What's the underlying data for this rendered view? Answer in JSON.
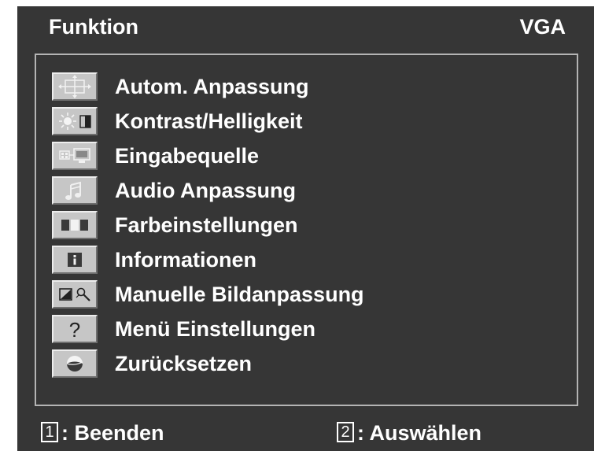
{
  "header": {
    "title": "Funktion",
    "source": "VGA"
  },
  "menu": {
    "items": [
      {
        "label": "Autom. Anpassung",
        "icon": "auto-adjust-icon"
      },
      {
        "label": "Kontrast/Helligkeit",
        "icon": "contrast-brightness-icon"
      },
      {
        "label": "Eingabequelle",
        "icon": "input-source-icon"
      },
      {
        "label": "Audio Anpassung",
        "icon": "audio-note-icon"
      },
      {
        "label": "Farbeinstellungen",
        "icon": "color-adjust-icon"
      },
      {
        "label": "Informationen",
        "icon": "info-icon"
      },
      {
        "label": "Manuelle Bildanpassung",
        "icon": "manual-image-adjust-icon"
      },
      {
        "label": "Menü Einstellungen",
        "icon": "question-mark-icon"
      },
      {
        "label": "Zurücksetzen",
        "icon": "reset-icon"
      }
    ]
  },
  "footer": {
    "exit": {
      "key": "1",
      "label": ": Beenden"
    },
    "select": {
      "key": "2",
      "label": ": Auswählen"
    }
  },
  "colors": {
    "background": "#363636",
    "text": "#ffffff",
    "icon_face": "#c6c6c6",
    "frame": "#b4b4b4"
  }
}
